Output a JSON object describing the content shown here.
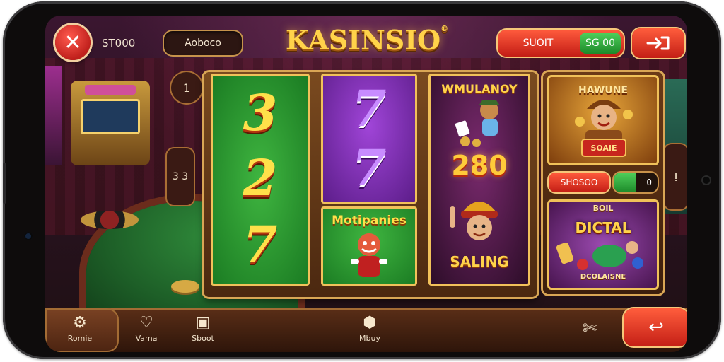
{
  "header": {
    "balance": "ST000",
    "account_button": "Aoboco",
    "logo": "KASINSIO",
    "logo_mark": "®",
    "bet_label": "SUOIT",
    "bet_value": "SG 00"
  },
  "side": {
    "left_top": "1",
    "left_mid": "3 3"
  },
  "reels": {
    "col1": [
      "3",
      "2",
      "7"
    ],
    "col2": [
      "7",
      "7"
    ],
    "col2_bonus": "Motipanies",
    "col3_title": "WMULANOY",
    "col3_value": "280",
    "col3_bottom": "SALING"
  },
  "panel": {
    "top_title": "HAWUNE",
    "top_ribbon": "SOAIE",
    "pill_left": "SHOSOO",
    "pill_right": "0",
    "pill_right_fill": 0.5,
    "bottom_title": "DICTAL",
    "bottom_sub": "DCOLAISNE"
  },
  "nav": {
    "items": [
      {
        "label": "Romie",
        "icon": "⚙"
      },
      {
        "label": "Vama",
        "icon": "♡"
      },
      {
        "label": "Sboot",
        "icon": "▣"
      },
      {
        "label": "Mbuy",
        "icon": "⬢"
      }
    ],
    "tools_icon": "✄",
    "back_icon": "↩"
  }
}
